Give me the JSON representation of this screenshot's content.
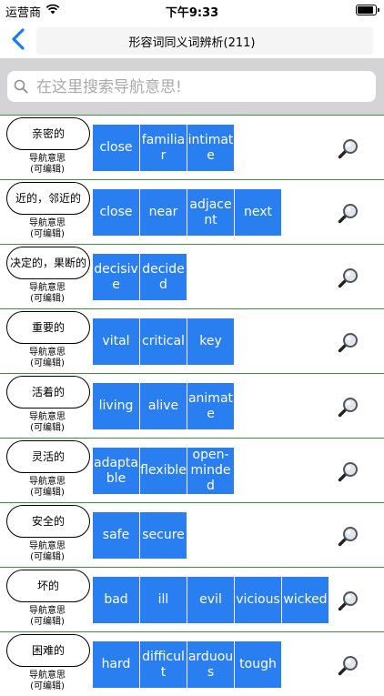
{
  "status_bar": {
    "carrier": "运营商",
    "time": "下午9:33"
  },
  "nav": {
    "title": "形容词同义词辨析(211)"
  },
  "search": {
    "placeholder": "在这里搜索导航意思!"
  },
  "hint_lines": [
    "导航意思",
    "(可编辑)"
  ],
  "rows": [
    {
      "title": "亲密的",
      "words": [
        "close",
        "familiar",
        "intimate"
      ]
    },
    {
      "title": "近的，邻近的",
      "words": [
        "close",
        "near",
        "adjacent",
        "next"
      ]
    },
    {
      "title": "决定的，果断的",
      "words": [
        "decisive",
        "decided"
      ]
    },
    {
      "title": "重要的",
      "words": [
        "vital",
        "critical",
        "key"
      ]
    },
    {
      "title": "活着的",
      "words": [
        "living",
        "alive",
        "animate"
      ]
    },
    {
      "title": "灵活的",
      "words": [
        "adaptable",
        "flexible",
        "open-minded"
      ]
    },
    {
      "title": "安全的",
      "words": [
        "safe",
        "secure"
      ]
    },
    {
      "title": "坏的",
      "words": [
        "bad",
        "ill",
        "evil",
        "vicious",
        "wicked"
      ]
    },
    {
      "title": "困难的",
      "words": [
        "hard",
        "difficult",
        "arduous",
        "tough"
      ]
    }
  ],
  "colors": {
    "accent": "#2a7ff0",
    "divider": "#3e8e3e",
    "search_bg": "#d4d4d6"
  }
}
